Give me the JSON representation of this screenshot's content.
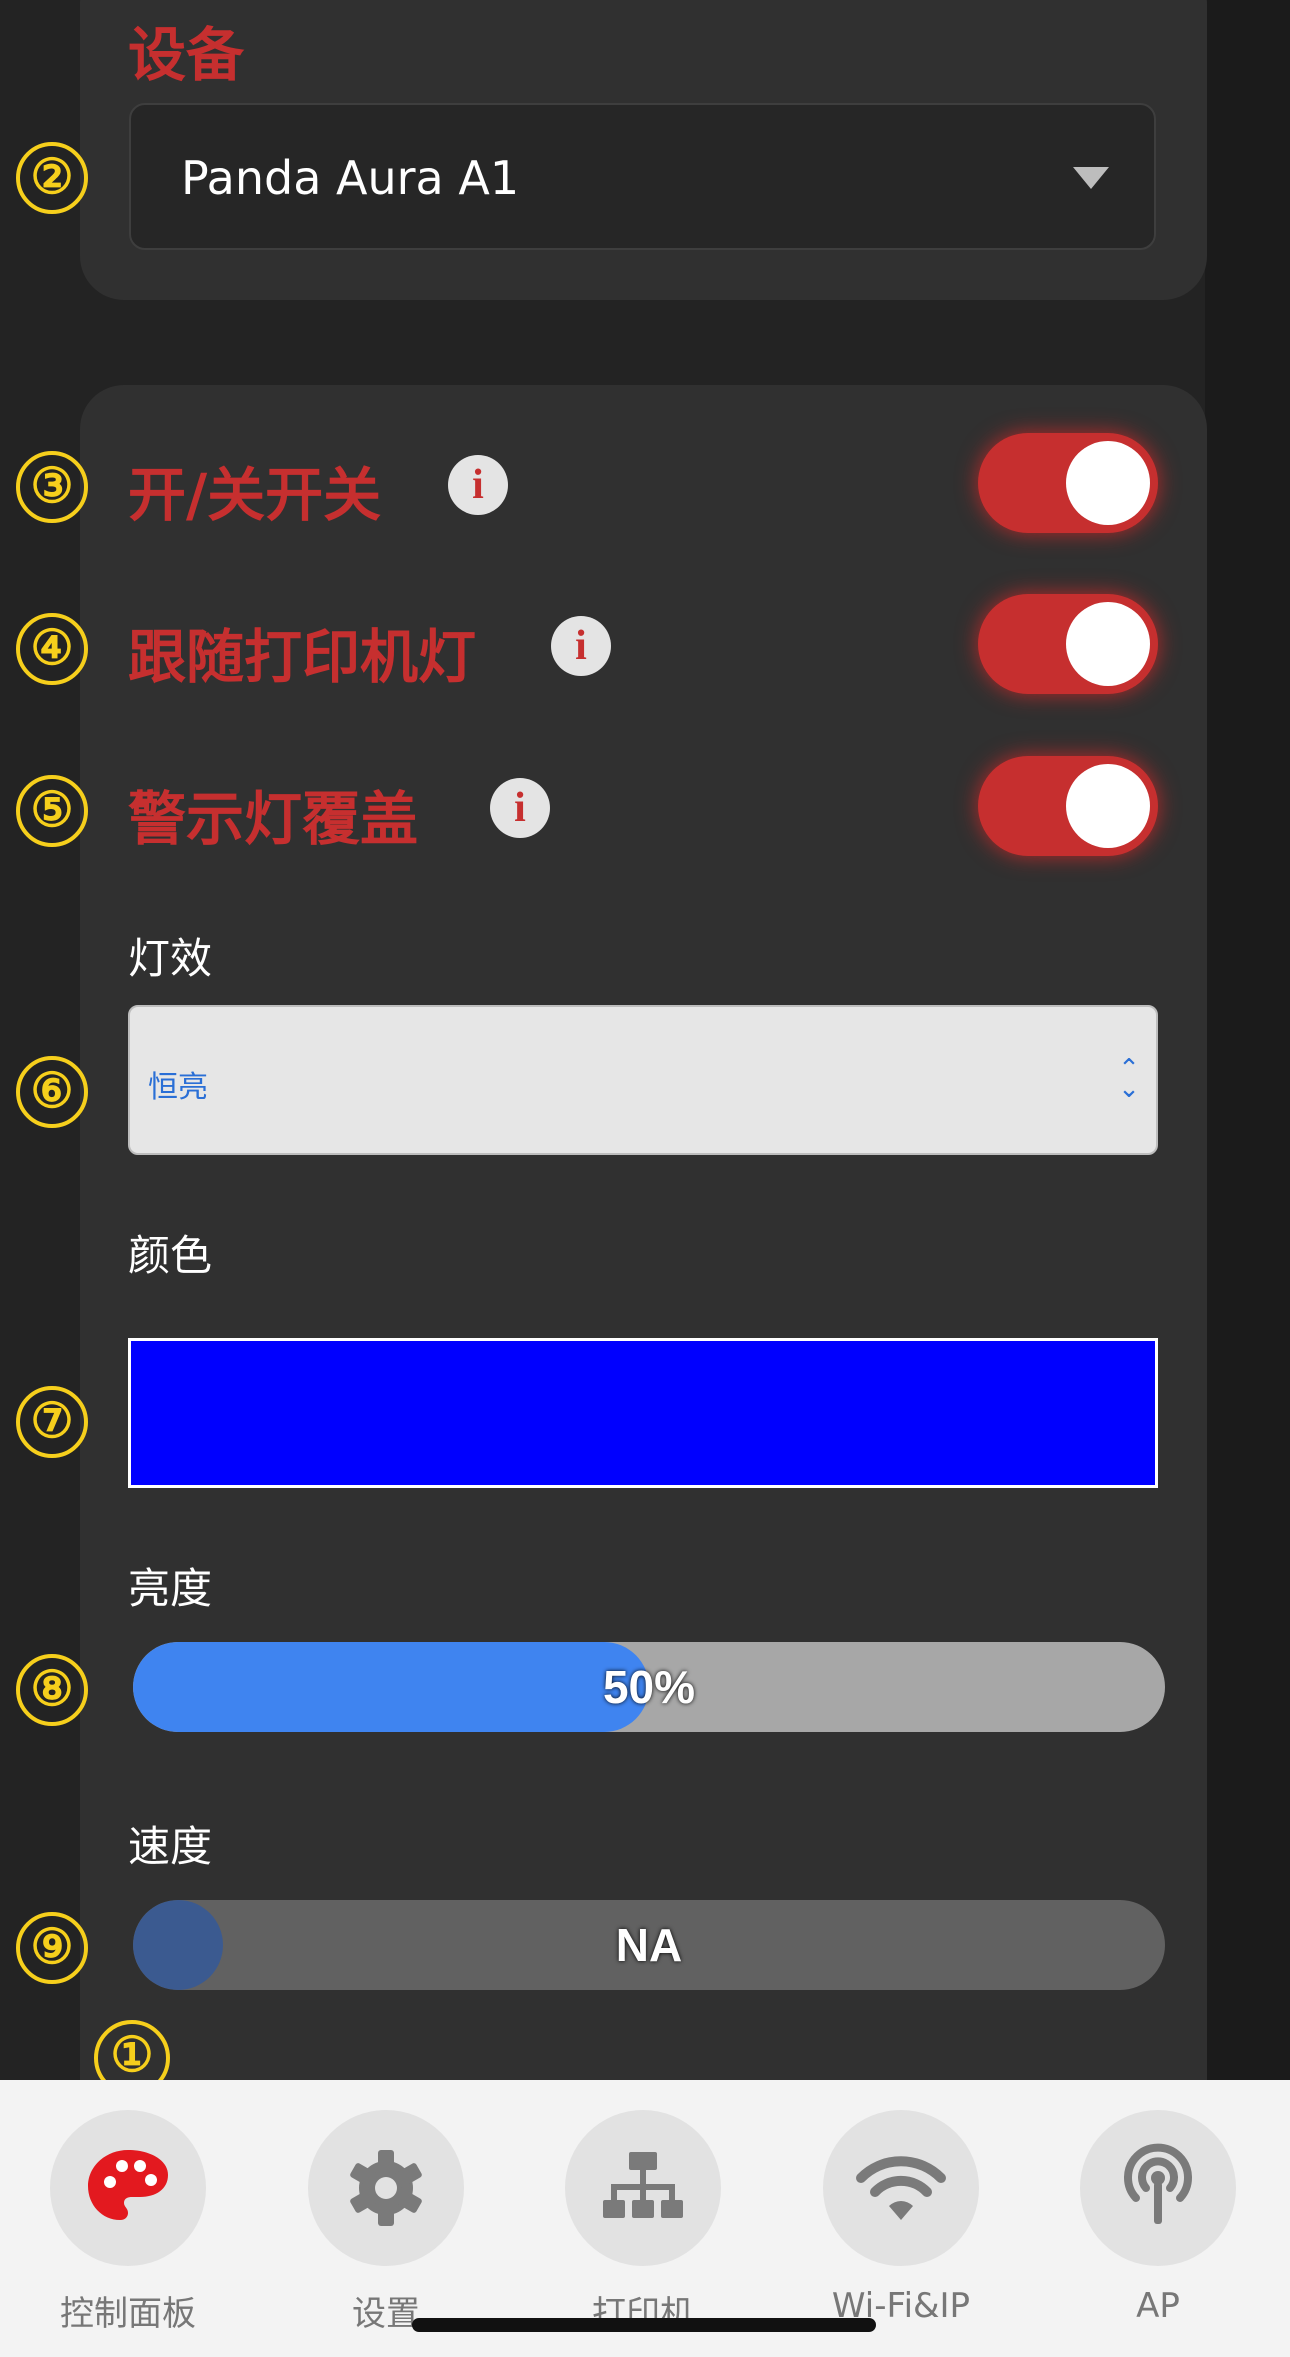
{
  "device": {
    "title": "设备",
    "selected": "Panda Aura A1"
  },
  "markers": [
    "①",
    "②",
    "③",
    "④",
    "⑤",
    "⑥",
    "⑦",
    "⑧",
    "⑨"
  ],
  "toggles": [
    {
      "label": "开/关开关",
      "on": true
    },
    {
      "label": "跟随打印机灯",
      "on": true
    },
    {
      "label": "警示灯覆盖",
      "on": true
    }
  ],
  "info_glyph": "i",
  "effect": {
    "label": "灯效",
    "value": "恒亮"
  },
  "color": {
    "label": "颜色",
    "value": "#0000ff"
  },
  "brightness": {
    "label": "亮度",
    "value_text": "50%",
    "fraction": 0.5
  },
  "speed": {
    "label": "速度",
    "value_text": "NA"
  },
  "tabs": [
    {
      "label": "控制面板",
      "icon": "palette-icon",
      "active": true
    },
    {
      "label": "设置",
      "icon": "gear-icon",
      "active": false
    },
    {
      "label": "打印机",
      "icon": "network-icon",
      "active": false
    },
    {
      "label": "Wi-Fi&IP",
      "icon": "wifi-icon",
      "active": false
    },
    {
      "label": "AP",
      "icon": "antenna-icon",
      "active": false
    }
  ],
  "colors": {
    "accent_red": "#c62f2f",
    "marker_yellow": "#f6cf1c",
    "bar_blue": "#3f84f0"
  }
}
